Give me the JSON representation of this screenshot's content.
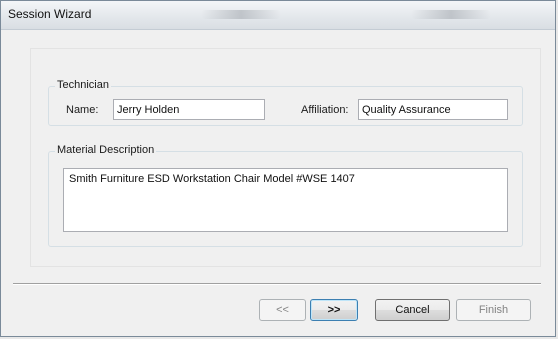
{
  "window": {
    "title": "Session Wizard"
  },
  "technician": {
    "group_label": "Technician",
    "name_label": "Name:",
    "name_value": "Jerry Holden",
    "affiliation_label": "Affiliation:",
    "affiliation_value": "Quality Assurance"
  },
  "material": {
    "group_label": "Material Description",
    "description_value": "Smith Furniture ESD Workstation Chair Model #WSE 1407"
  },
  "buttons": {
    "prev_label": "<<",
    "next_label": ">>",
    "cancel_label": "Cancel",
    "finish_label": "Finish"
  }
}
